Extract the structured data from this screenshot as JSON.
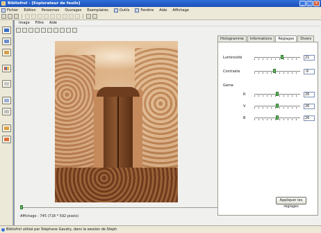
{
  "window": {
    "title": "Bibliofrol - [Explorateur de feuils]"
  },
  "menu": {
    "items": [
      "Fichier",
      "Edition",
      "Personnes",
      "Ouvrages",
      "Exemplaires",
      "Outils",
      "Fenêtre",
      "Aide",
      "Affichage"
    ]
  },
  "subtabs": [
    "Image",
    "Filtre",
    "Aide"
  ],
  "panel": {
    "tabs": [
      "Histogramme",
      "Informations",
      "Réglages",
      "Divers"
    ],
    "active_tab": "Réglages",
    "luminosite": {
      "label": "Luminosité",
      "value": "21",
      "level": 0.62
    },
    "contraste": {
      "label": "Contraste",
      "value": "-9",
      "level": 0.44
    },
    "gamma": {
      "label": "Gama"
    },
    "r": {
      "label": "R",
      "value": "26",
      "level": 0.5
    },
    "v": {
      "label": "V",
      "value": "26",
      "level": 0.5
    },
    "b": {
      "label": "B",
      "value": "26",
      "level": 0.5
    }
  },
  "affichage": "Affichage : 745 (718 * 592 pixels)",
  "apply_label": "Appliquer les réglages",
  "status": "Bibliofrol utilisé par Stéphane Gaudry, dans la session de Steph"
}
